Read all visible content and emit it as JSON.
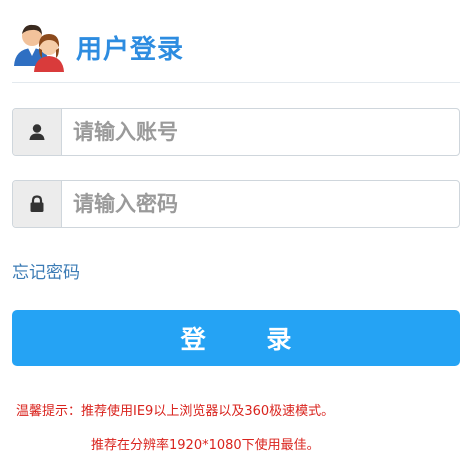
{
  "header": {
    "icon": "users-icon",
    "title": "用户登录"
  },
  "username": {
    "icon": "user-icon",
    "placeholder": "请输入账号",
    "value": ""
  },
  "password": {
    "icon": "lock-icon",
    "placeholder": "请输入密码",
    "value": ""
  },
  "forgot_password": "忘记密码",
  "login_button": "登 录",
  "tips": {
    "line1": "温馨提示：推荐使用IE9以上浏览器以及360极速模式。",
    "line2": "推荐在分辨率1920*1080下使用最佳。"
  },
  "colors": {
    "title": "#2d8ce0",
    "button": "#25a3f4",
    "link": "#3b7bb5",
    "tip": "#d9231d"
  }
}
